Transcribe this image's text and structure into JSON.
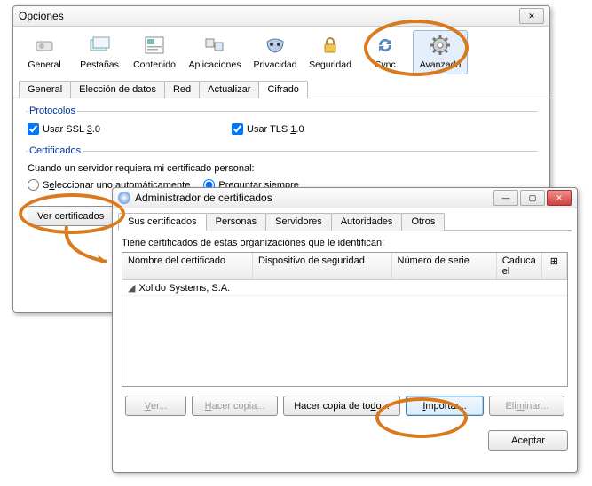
{
  "options_window": {
    "title": "Opciones",
    "toolbar": [
      {
        "label": "General"
      },
      {
        "label": "Pestañas"
      },
      {
        "label": "Contenido"
      },
      {
        "label": "Aplicaciones"
      },
      {
        "label": "Privacidad"
      },
      {
        "label": "Seguridad"
      },
      {
        "label": "Sync"
      },
      {
        "label": "Avanzado"
      }
    ],
    "subtabs": [
      "General",
      "Elección de datos",
      "Red",
      "Actualizar",
      "Cifrado"
    ],
    "subtab_selected": 4,
    "protocols_legend": "Protocolos",
    "use_ssl_label": "Usar SSL 3.0",
    "use_tls_label": "Usar TLS 1.0",
    "certs_legend": "Certificados",
    "certs_desc": "Cuando un servidor requiera mi certificado personal:",
    "radio_auto": "Seleccionar uno automáticamente",
    "radio_ask": "Preguntar siempre",
    "view_certs_btn": "Ver certificados"
  },
  "cert_window": {
    "title": "Administrador de certificados",
    "tabs": [
      "Sus certificados",
      "Personas",
      "Servidores",
      "Autoridades",
      "Otros"
    ],
    "tab_selected": 0,
    "desc": "Tiene certificados de estas organizaciones que le identifican:",
    "columns": {
      "name": "Nombre del certificado",
      "device": "Dispositivo de seguridad",
      "serial": "Número de serie",
      "expires": "Caduca el"
    },
    "rows": [
      {
        "name": "Xolido Systems, S.A."
      }
    ],
    "buttons": {
      "view": "Ver...",
      "backup": "Hacer copia...",
      "backup_all": "Hacer copia de todo...",
      "import": "Importar...",
      "delete": "Eliminar..."
    },
    "ok": "Aceptar"
  }
}
